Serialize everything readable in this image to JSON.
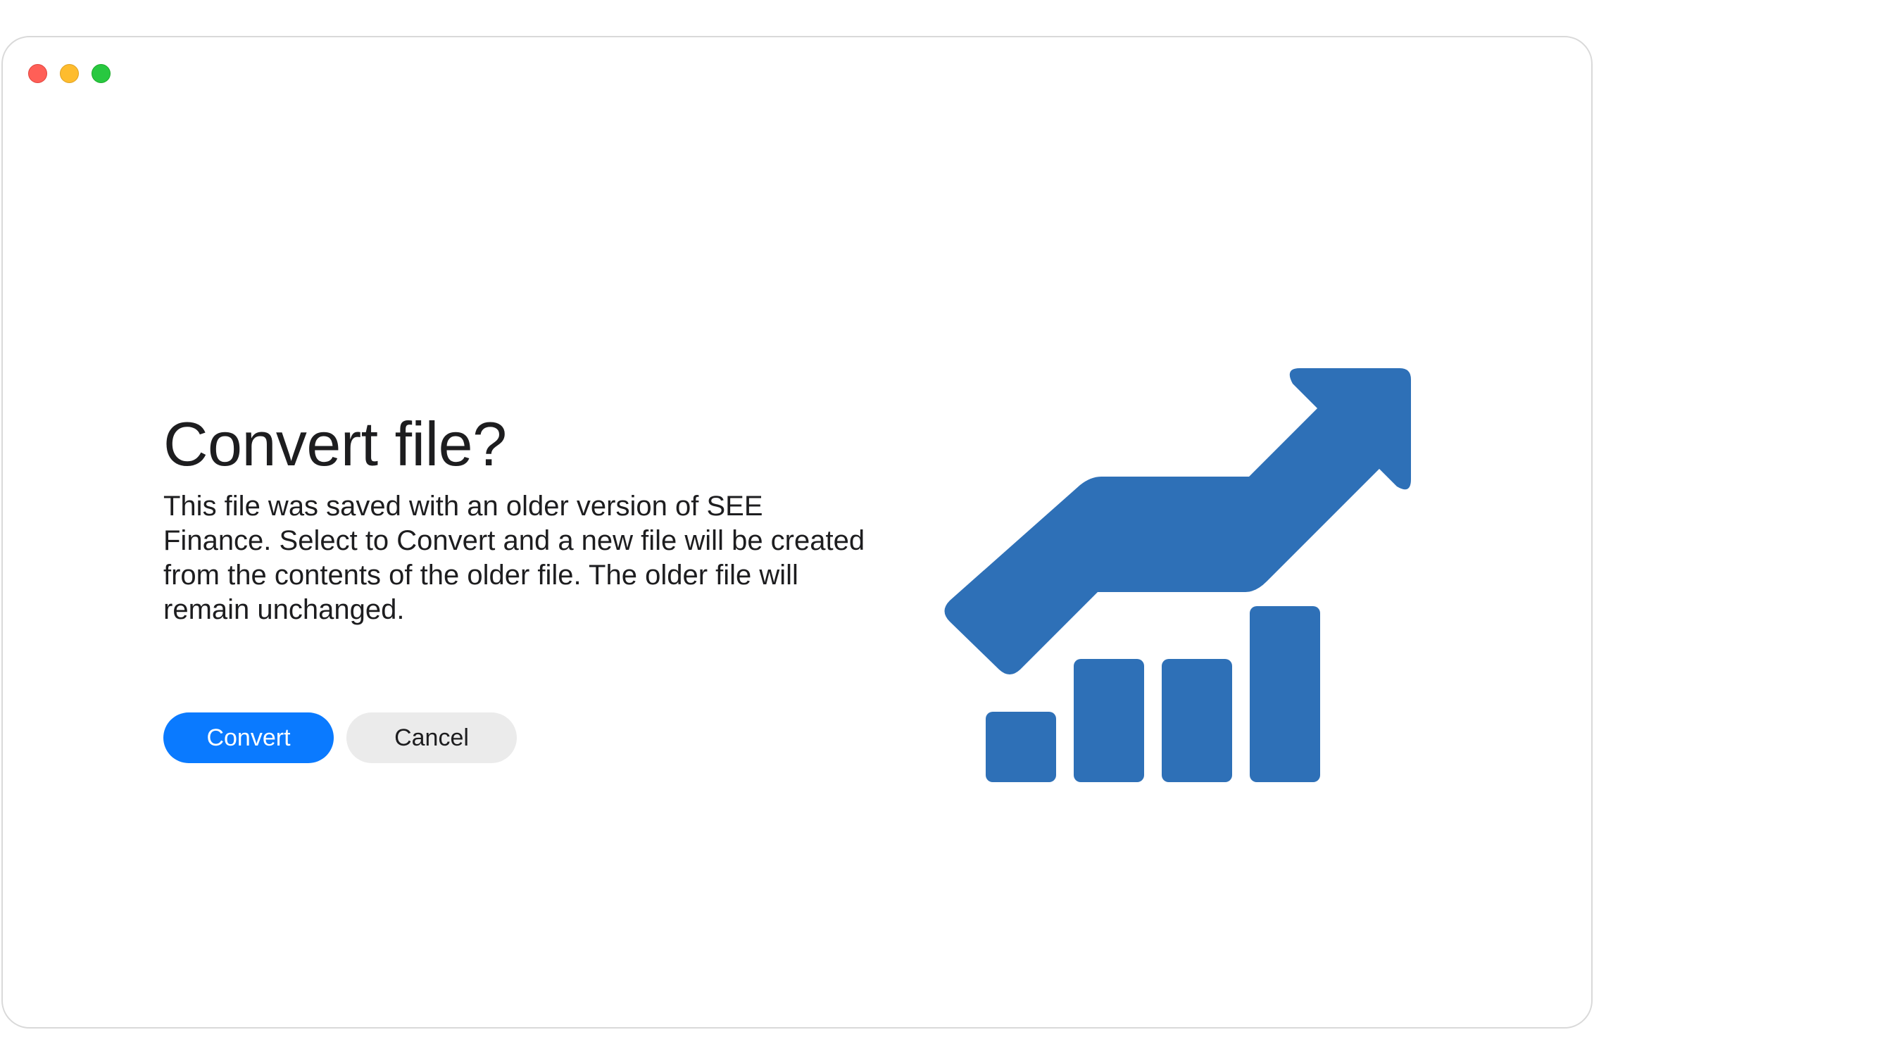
{
  "window": {
    "controls": {
      "close": "close",
      "minimize": "minimize",
      "zoom": "zoom"
    }
  },
  "dialog": {
    "title": "Convert file?",
    "message": "This file was saved with an older version of SEE Finance. Select to Convert and a new file will be created from the contents of the older file.  The older file will remain unchanged.",
    "convert_label": "Convert",
    "cancel_label": "Cancel"
  },
  "illustration": {
    "icon": "finance-growth-icon",
    "color": "#2e70b7"
  },
  "colors": {
    "accent": "#0a7aff",
    "secondary_button": "#ebebeb",
    "text": "#1d1d1f"
  }
}
